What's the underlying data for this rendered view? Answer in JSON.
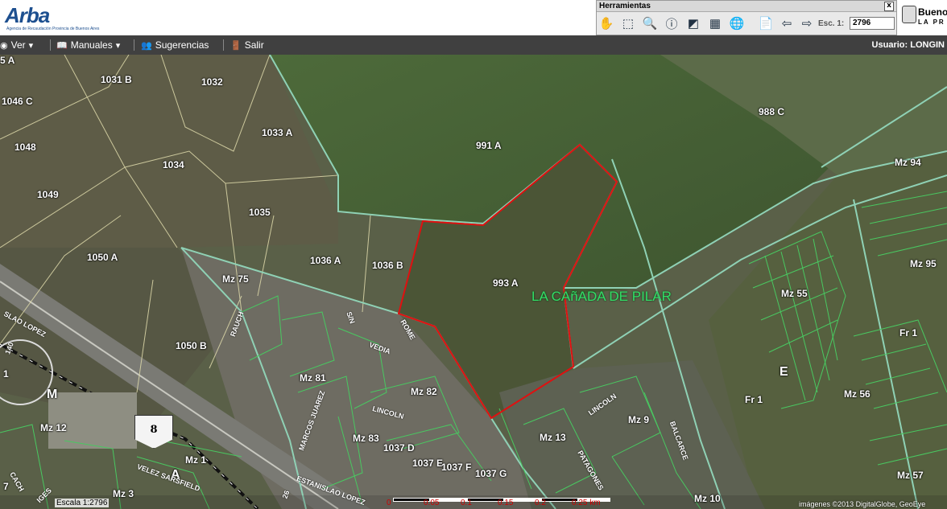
{
  "header": {
    "logo_text": "Arba",
    "logo_tagline": "Agencia de Recaudación Provincia de Buenos Aires",
    "brand_line1": "Buenos",
    "brand_line2": "LA PR"
  },
  "tools": {
    "title": "Herramientas",
    "close_glyph": "x",
    "buttons": [
      "hand-pan",
      "zoom-in",
      "zoom-out",
      "info",
      "measure",
      "grid",
      "globe",
      "pdf",
      "back-arrow",
      "forward-arrow"
    ],
    "scale_label": "Esc. 1:",
    "scale_value": "2796"
  },
  "menu": {
    "items": [
      {
        "icon": "eye-icon",
        "label": "Ver",
        "has_dropdown": true
      },
      {
        "icon": "book-icon",
        "label": "Manuales",
        "has_dropdown": true
      },
      {
        "icon": "people-icon",
        "label": "Sugerencias",
        "has_dropdown": false
      },
      {
        "icon": "exit-icon",
        "label": "Salir",
        "has_dropdown": false
      }
    ],
    "user_label": "Usuario: LONGIN"
  },
  "map": {
    "parcels": [
      "5 A",
      "1031 B",
      "1032",
      "1046 C",
      "1048",
      "1033 A",
      "991 A",
      "988 C",
      "1034",
      "1049",
      "1035",
      "Mz 94",
      "1050 A",
      "1036 A",
      "1036 B",
      "Mz 75",
      "993 A",
      "Mz 95",
      "Mz 55",
      "Fr 1",
      "1050 B",
      "Mz 81",
      "Mz 82",
      "E",
      "Fr 1",
      "Mz 56",
      "M",
      "Mz 12",
      "Mz 9",
      "Mz 83",
      "Mz 13",
      "1037 D",
      "1037 E",
      "1037 F",
      "Mz 1",
      "1037 G",
      "A",
      "Mz 3",
      "Mz 57",
      "Mz 10",
      "1",
      "7"
    ],
    "area_name": "LA CAñADA DE PILAR",
    "streets": [
      "SLAO LOPEZ",
      "RAUCH",
      "S/N",
      "ROME",
      "VEDIA",
      "LINCOLN",
      "MARCOS JUAREZ",
      "LINCOLN",
      "BALCARCE",
      "PATAGONES",
      "ESTANISLAO LOPEZ",
      "VELEZ SARSFIELD",
      "CACH",
      "IGES",
      "26",
      "140"
    ],
    "route_shield": "8",
    "scale_text": "Escala 1:2796",
    "scale_ticks": [
      "0",
      "0.05",
      "0.1",
      "0.15",
      "0.2",
      "0.25 km"
    ],
    "copyright": "imágenes ©2013 DigitalGlobe, GeoEye"
  }
}
